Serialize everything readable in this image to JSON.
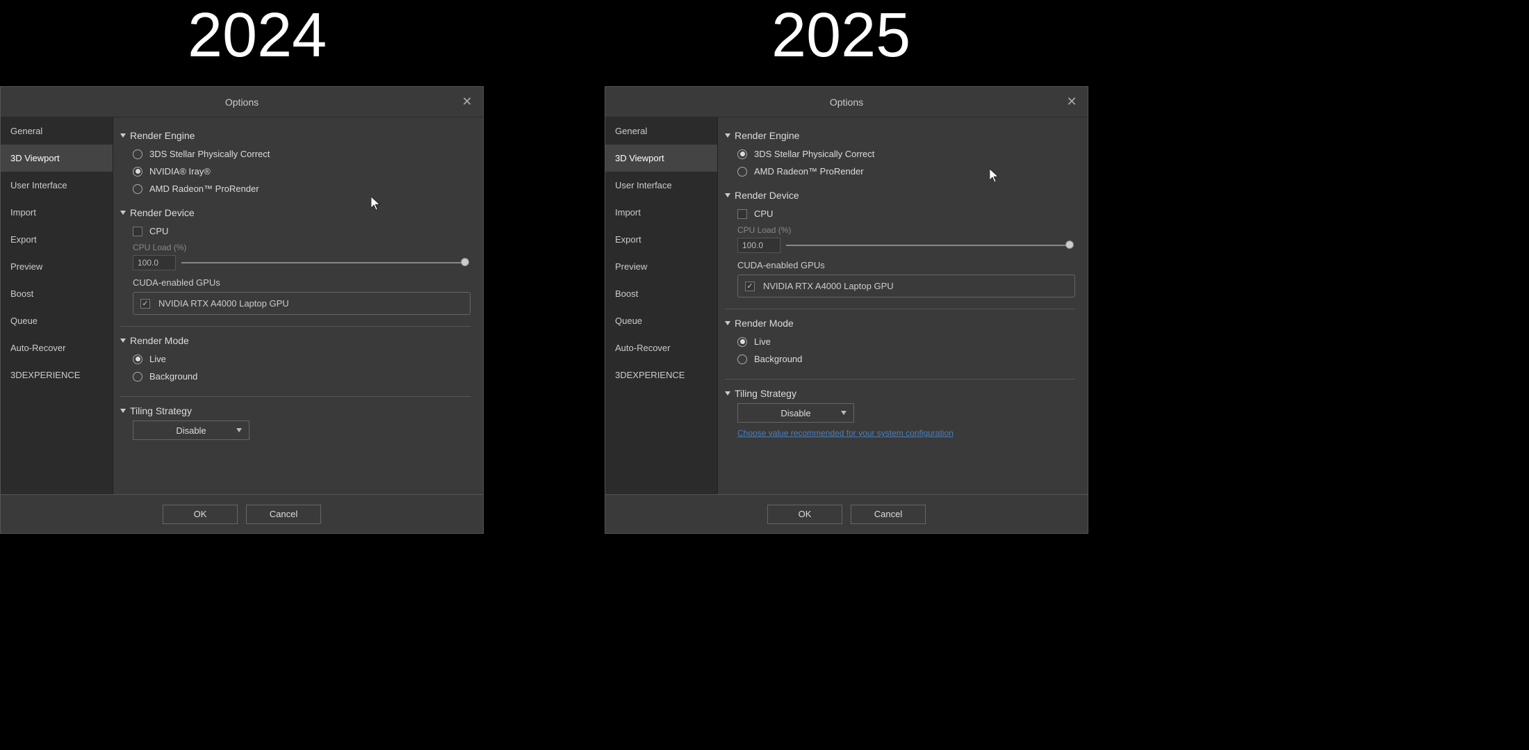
{
  "years": {
    "left": "2024",
    "right": "2025"
  },
  "dialog": {
    "title": "Options",
    "sidebar": [
      "General",
      "3D Viewport",
      "User Interface",
      "Import",
      "Export",
      "Preview",
      "Boost",
      "Queue",
      "Auto-Recover",
      "3DEXPERIENCE"
    ],
    "active_index": 1,
    "sections": {
      "render_engine": {
        "title": "Render Engine",
        "options_2024": [
          "3DS Stellar Physically Correct",
          "NVIDIA® Iray®",
          "AMD Radeon™ ProRender"
        ],
        "selected_2024": 1,
        "options_2025": [
          "3DS Stellar Physically Correct",
          "AMD Radeon™ ProRender"
        ],
        "selected_2025": 0
      },
      "render_device": {
        "title": "Render Device",
        "cpu_label": "CPU",
        "cpu_load_label": "CPU Load (%)",
        "cpu_load_value": "100.0",
        "cuda_label": "CUDA-enabled GPUs",
        "gpu_name": "NVIDIA RTX A4000 Laptop GPU"
      },
      "render_mode": {
        "title": "Render Mode",
        "options": [
          "Live",
          "Background"
        ],
        "selected": 0
      },
      "tiling": {
        "title": "Tiling Strategy",
        "value": "Disable",
        "recommend_link": "Choose value recommended for your system configuration"
      }
    },
    "buttons": {
      "ok": "OK",
      "cancel": "Cancel"
    }
  }
}
